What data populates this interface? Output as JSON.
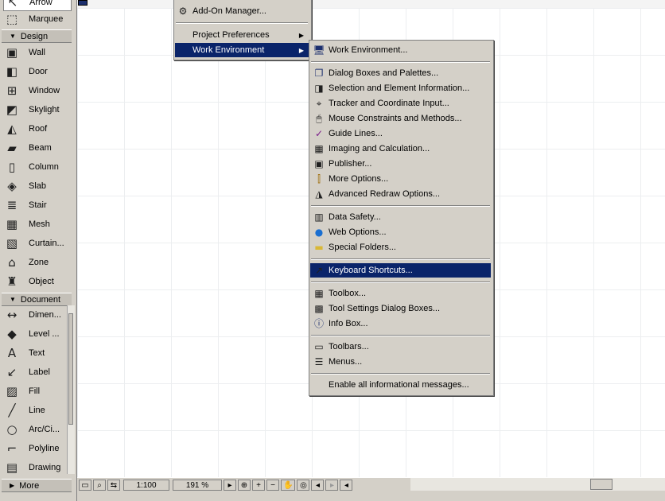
{
  "toolbox": {
    "tools_top": [
      {
        "label": "Arrow",
        "icon": "arrow-icon"
      },
      {
        "label": "Marquee",
        "icon": "marquee-icon"
      }
    ],
    "design_header": "Design",
    "design_tools": [
      {
        "label": "Wall",
        "icon": "wall-icon"
      },
      {
        "label": "Door",
        "icon": "door-icon"
      },
      {
        "label": "Window",
        "icon": "window-icon"
      },
      {
        "label": "Skylight",
        "icon": "skylight-icon"
      },
      {
        "label": "Roof",
        "icon": "roof-icon"
      },
      {
        "label": "Beam",
        "icon": "beam-icon"
      },
      {
        "label": "Column",
        "icon": "column-icon"
      },
      {
        "label": "Slab",
        "icon": "slab-icon"
      },
      {
        "label": "Stair",
        "icon": "stair-icon"
      },
      {
        "label": "Mesh",
        "icon": "mesh-icon"
      },
      {
        "label": "Curtain...",
        "icon": "curtain-wall-icon"
      },
      {
        "label": "Zone",
        "icon": "zone-icon"
      },
      {
        "label": "Object",
        "icon": "object-icon"
      }
    ],
    "document_header": "Document",
    "document_tools": [
      {
        "label": "Dimen...",
        "icon": "dimension-icon"
      },
      {
        "label": "Level ...",
        "icon": "level-dimension-icon"
      },
      {
        "label": "Text",
        "icon": "text-icon"
      },
      {
        "label": "Label",
        "icon": "label-icon"
      },
      {
        "label": "Fill",
        "icon": "fill-icon"
      },
      {
        "label": "Line",
        "icon": "line-icon"
      },
      {
        "label": "Arc/Ci...",
        "icon": "arc-circle-icon"
      },
      {
        "label": "Polyline",
        "icon": "polyline-icon"
      },
      {
        "label": "Drawing",
        "icon": "drawing-icon"
      }
    ],
    "more_label": "More"
  },
  "options_menu": {
    "items": [
      {
        "label": "Add-On Manager...",
        "icon": "addon-manager-icon",
        "submenu": false
      },
      {
        "label": "Project Preferences",
        "icon": "",
        "submenu": true
      },
      {
        "label": "Work Environment",
        "icon": "",
        "submenu": true,
        "highlighted": true
      }
    ]
  },
  "work_env_menu": {
    "groups": [
      [
        {
          "label": "Work Environment...",
          "icon": "work-environment-icon"
        }
      ],
      [
        {
          "label": "Dialog Boxes and Palettes...",
          "icon": "dialog-boxes-icon"
        },
        {
          "label": "Selection and Element Information...",
          "icon": "selection-info-icon"
        },
        {
          "label": "Tracker and Coordinate Input...",
          "icon": "tracker-icon"
        },
        {
          "label": "Mouse Constraints and Methods...",
          "icon": "mouse-icon"
        },
        {
          "label": "Guide Lines...",
          "icon": "guide-lines-icon"
        },
        {
          "label": "Imaging and Calculation...",
          "icon": "imaging-icon"
        },
        {
          "label": "Publisher...",
          "icon": "publisher-icon"
        },
        {
          "label": "More Options...",
          "icon": "more-options-icon"
        },
        {
          "label": "Advanced Redraw Options...",
          "icon": "redraw-icon"
        }
      ],
      [
        {
          "label": "Data Safety...",
          "icon": "data-safety-icon"
        },
        {
          "label": "Web Options...",
          "icon": "web-globe-icon"
        },
        {
          "label": "Special Folders...",
          "icon": "folder-icon"
        }
      ],
      [
        {
          "label": "Keyboard Shortcuts...",
          "icon": "keyboard-shortcuts-icon",
          "highlighted": true
        }
      ],
      [
        {
          "label": "Toolbox...",
          "icon": "toolbox-icon"
        },
        {
          "label": "Tool Settings Dialog Boxes...",
          "icon": "tool-settings-icon"
        },
        {
          "label": "Info Box...",
          "icon": "info-box-icon"
        }
      ],
      [
        {
          "label": "Toolbars...",
          "icon": "toolbars-icon"
        },
        {
          "label": "Menus...",
          "icon": "menus-icon"
        }
      ],
      [
        {
          "label": "Enable all informational messages...",
          "icon": ""
        }
      ]
    ]
  },
  "statusbar": {
    "scale": "1:100",
    "zoom": "191 %"
  },
  "colors": {
    "highlight": "#0a246a",
    "chrome": "#d4d0c8"
  }
}
